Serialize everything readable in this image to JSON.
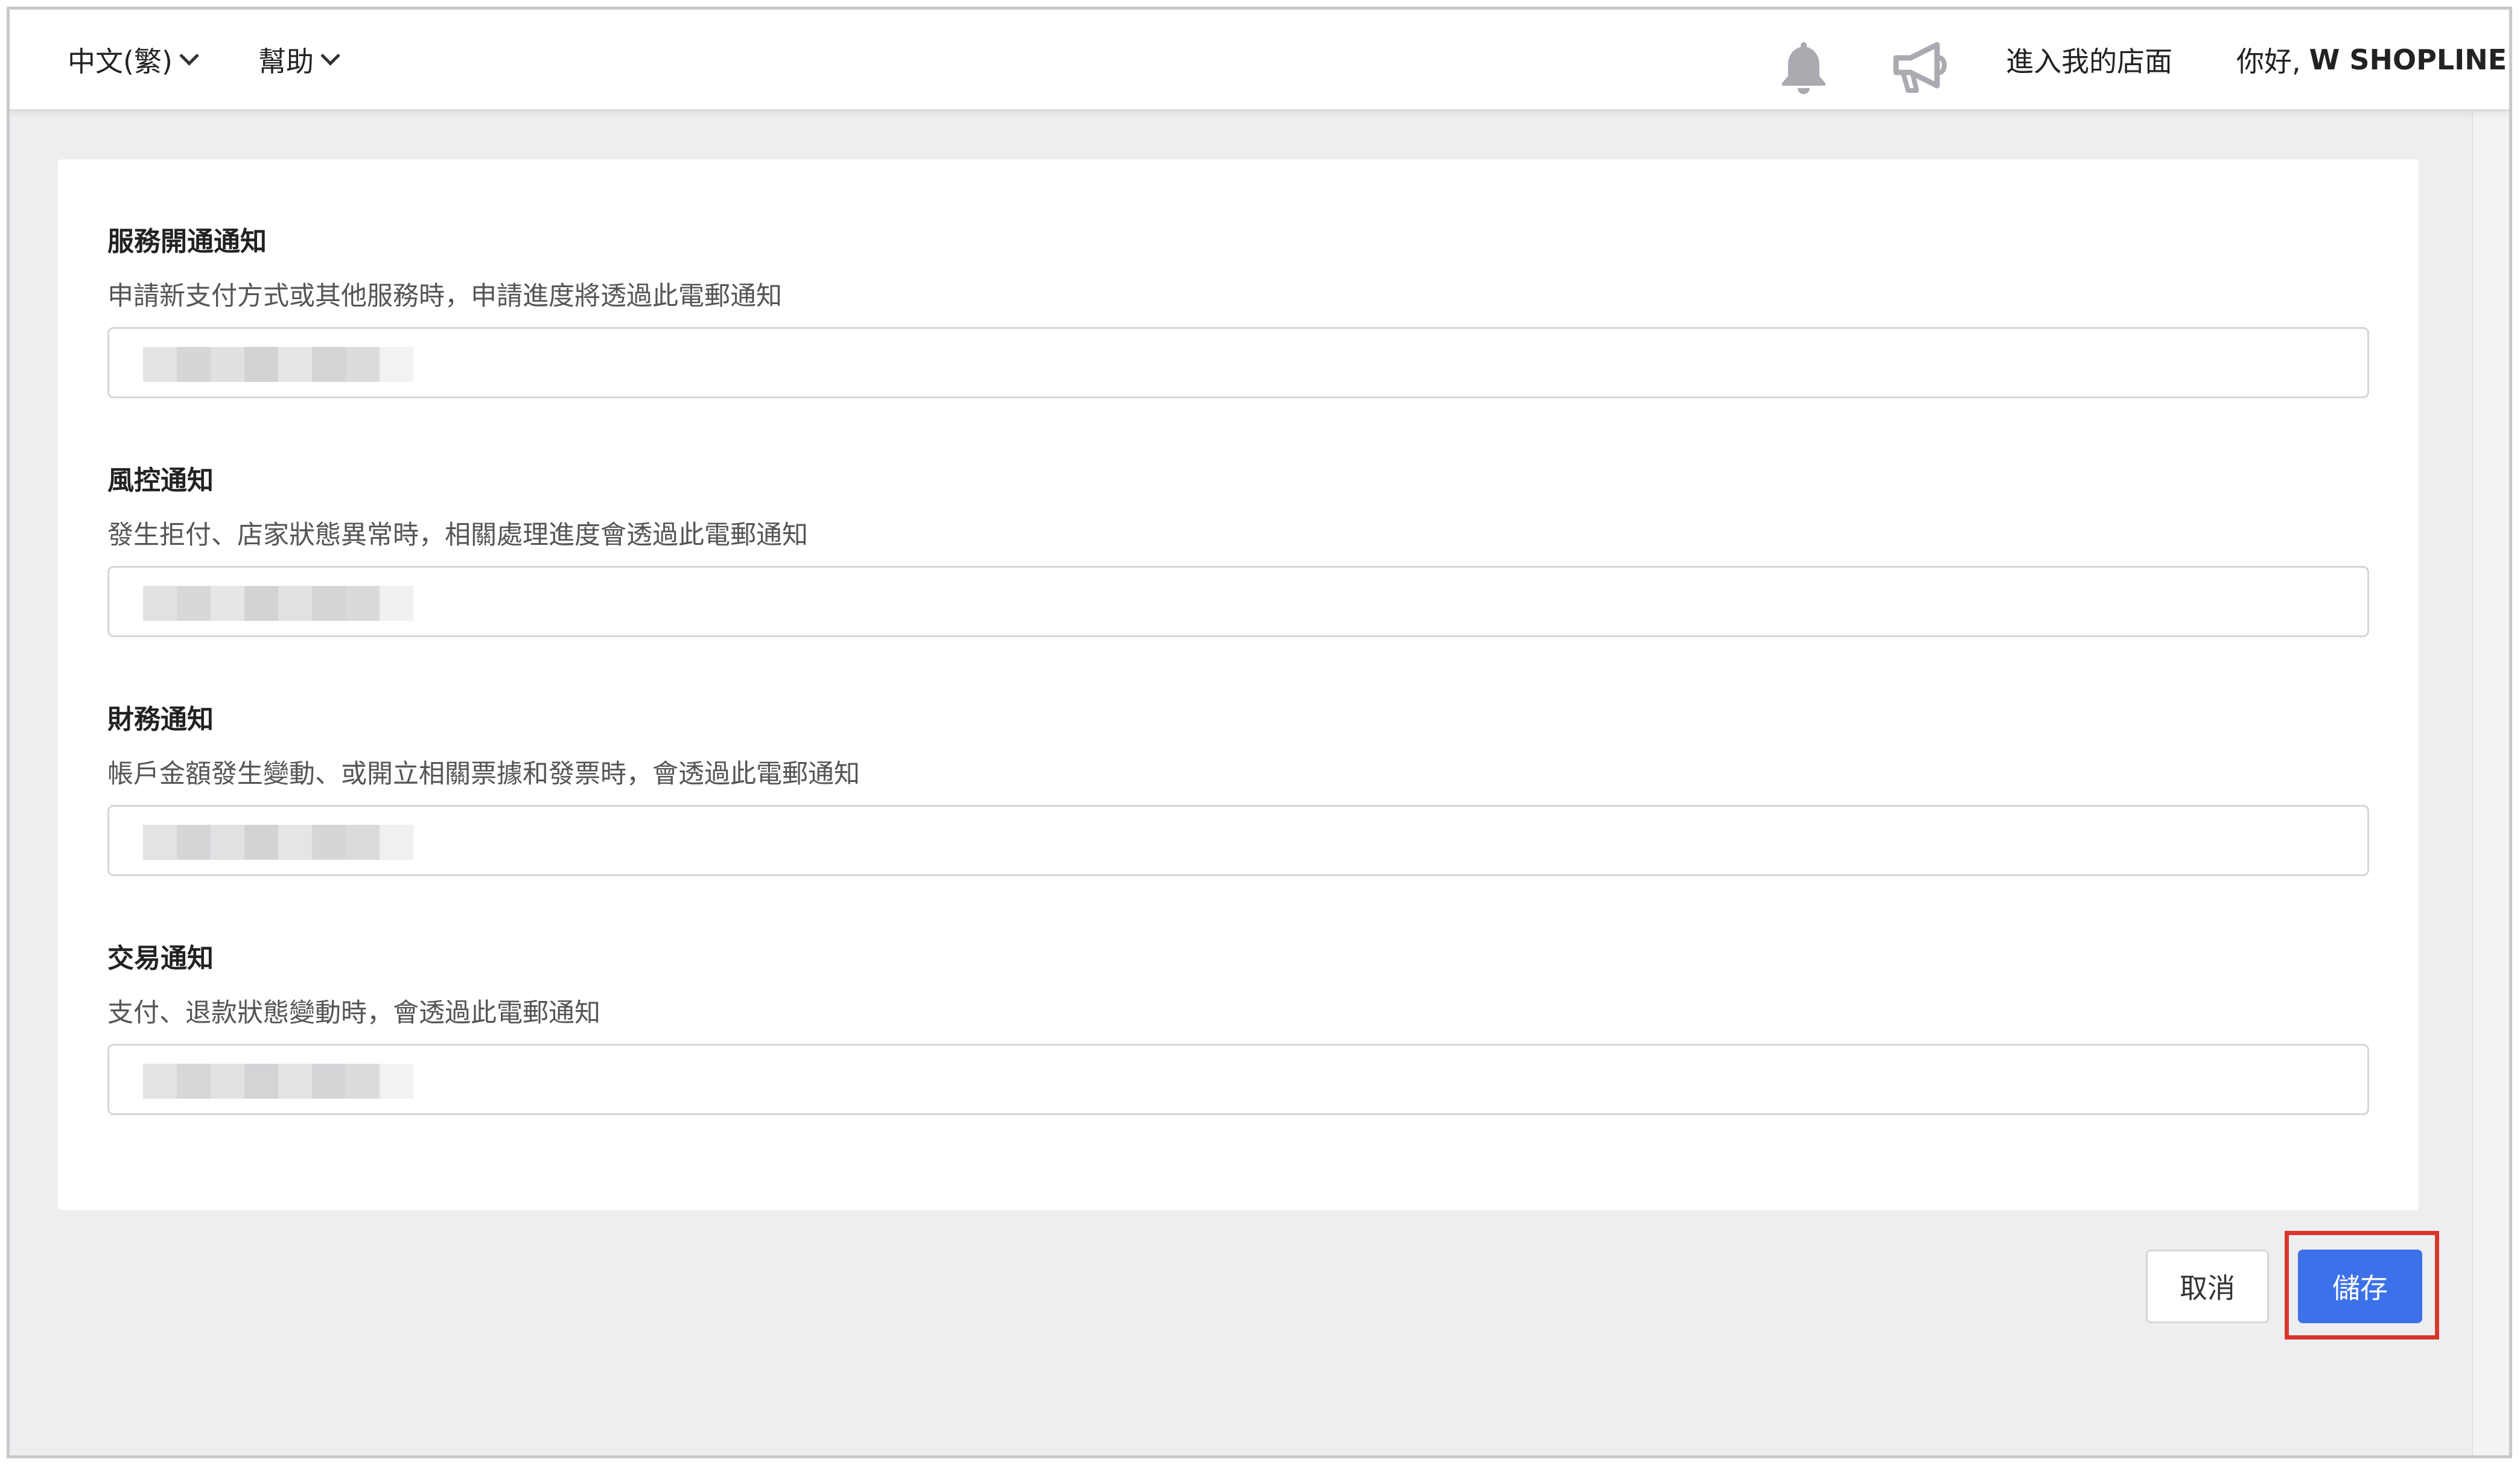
{
  "topbar": {
    "language_label": "中文(繁)",
    "help_label": "幫助",
    "notifications_icon": "bell-icon",
    "announcements_icon": "megaphone-icon",
    "store_link_label": "進入我的店面",
    "greeting_prefix": "你好,",
    "user_name": "W SHOPLINE"
  },
  "sections": [
    {
      "title": "服務開通通知",
      "description": "申請新支付方式或其他服務時，申請進度將透過此電郵通知"
    },
    {
      "title": "風控通知",
      "description": "發生拒付、店家狀態異常時，相關處理進度會透過此電郵通知"
    },
    {
      "title": "財務通知",
      "description": "帳戶金額發生變動、或開立相關票據和發票時，會透過此電郵通知"
    },
    {
      "title": "交易通知",
      "description": "支付、退款狀態變動時，會透過此電郵通知"
    }
  ],
  "actions": {
    "cancel_label": "取消",
    "save_label": "儲存"
  },
  "colors": {
    "primary": "#3d71ea",
    "highlight_border": "#d9362b",
    "background": "#eeeef0"
  }
}
